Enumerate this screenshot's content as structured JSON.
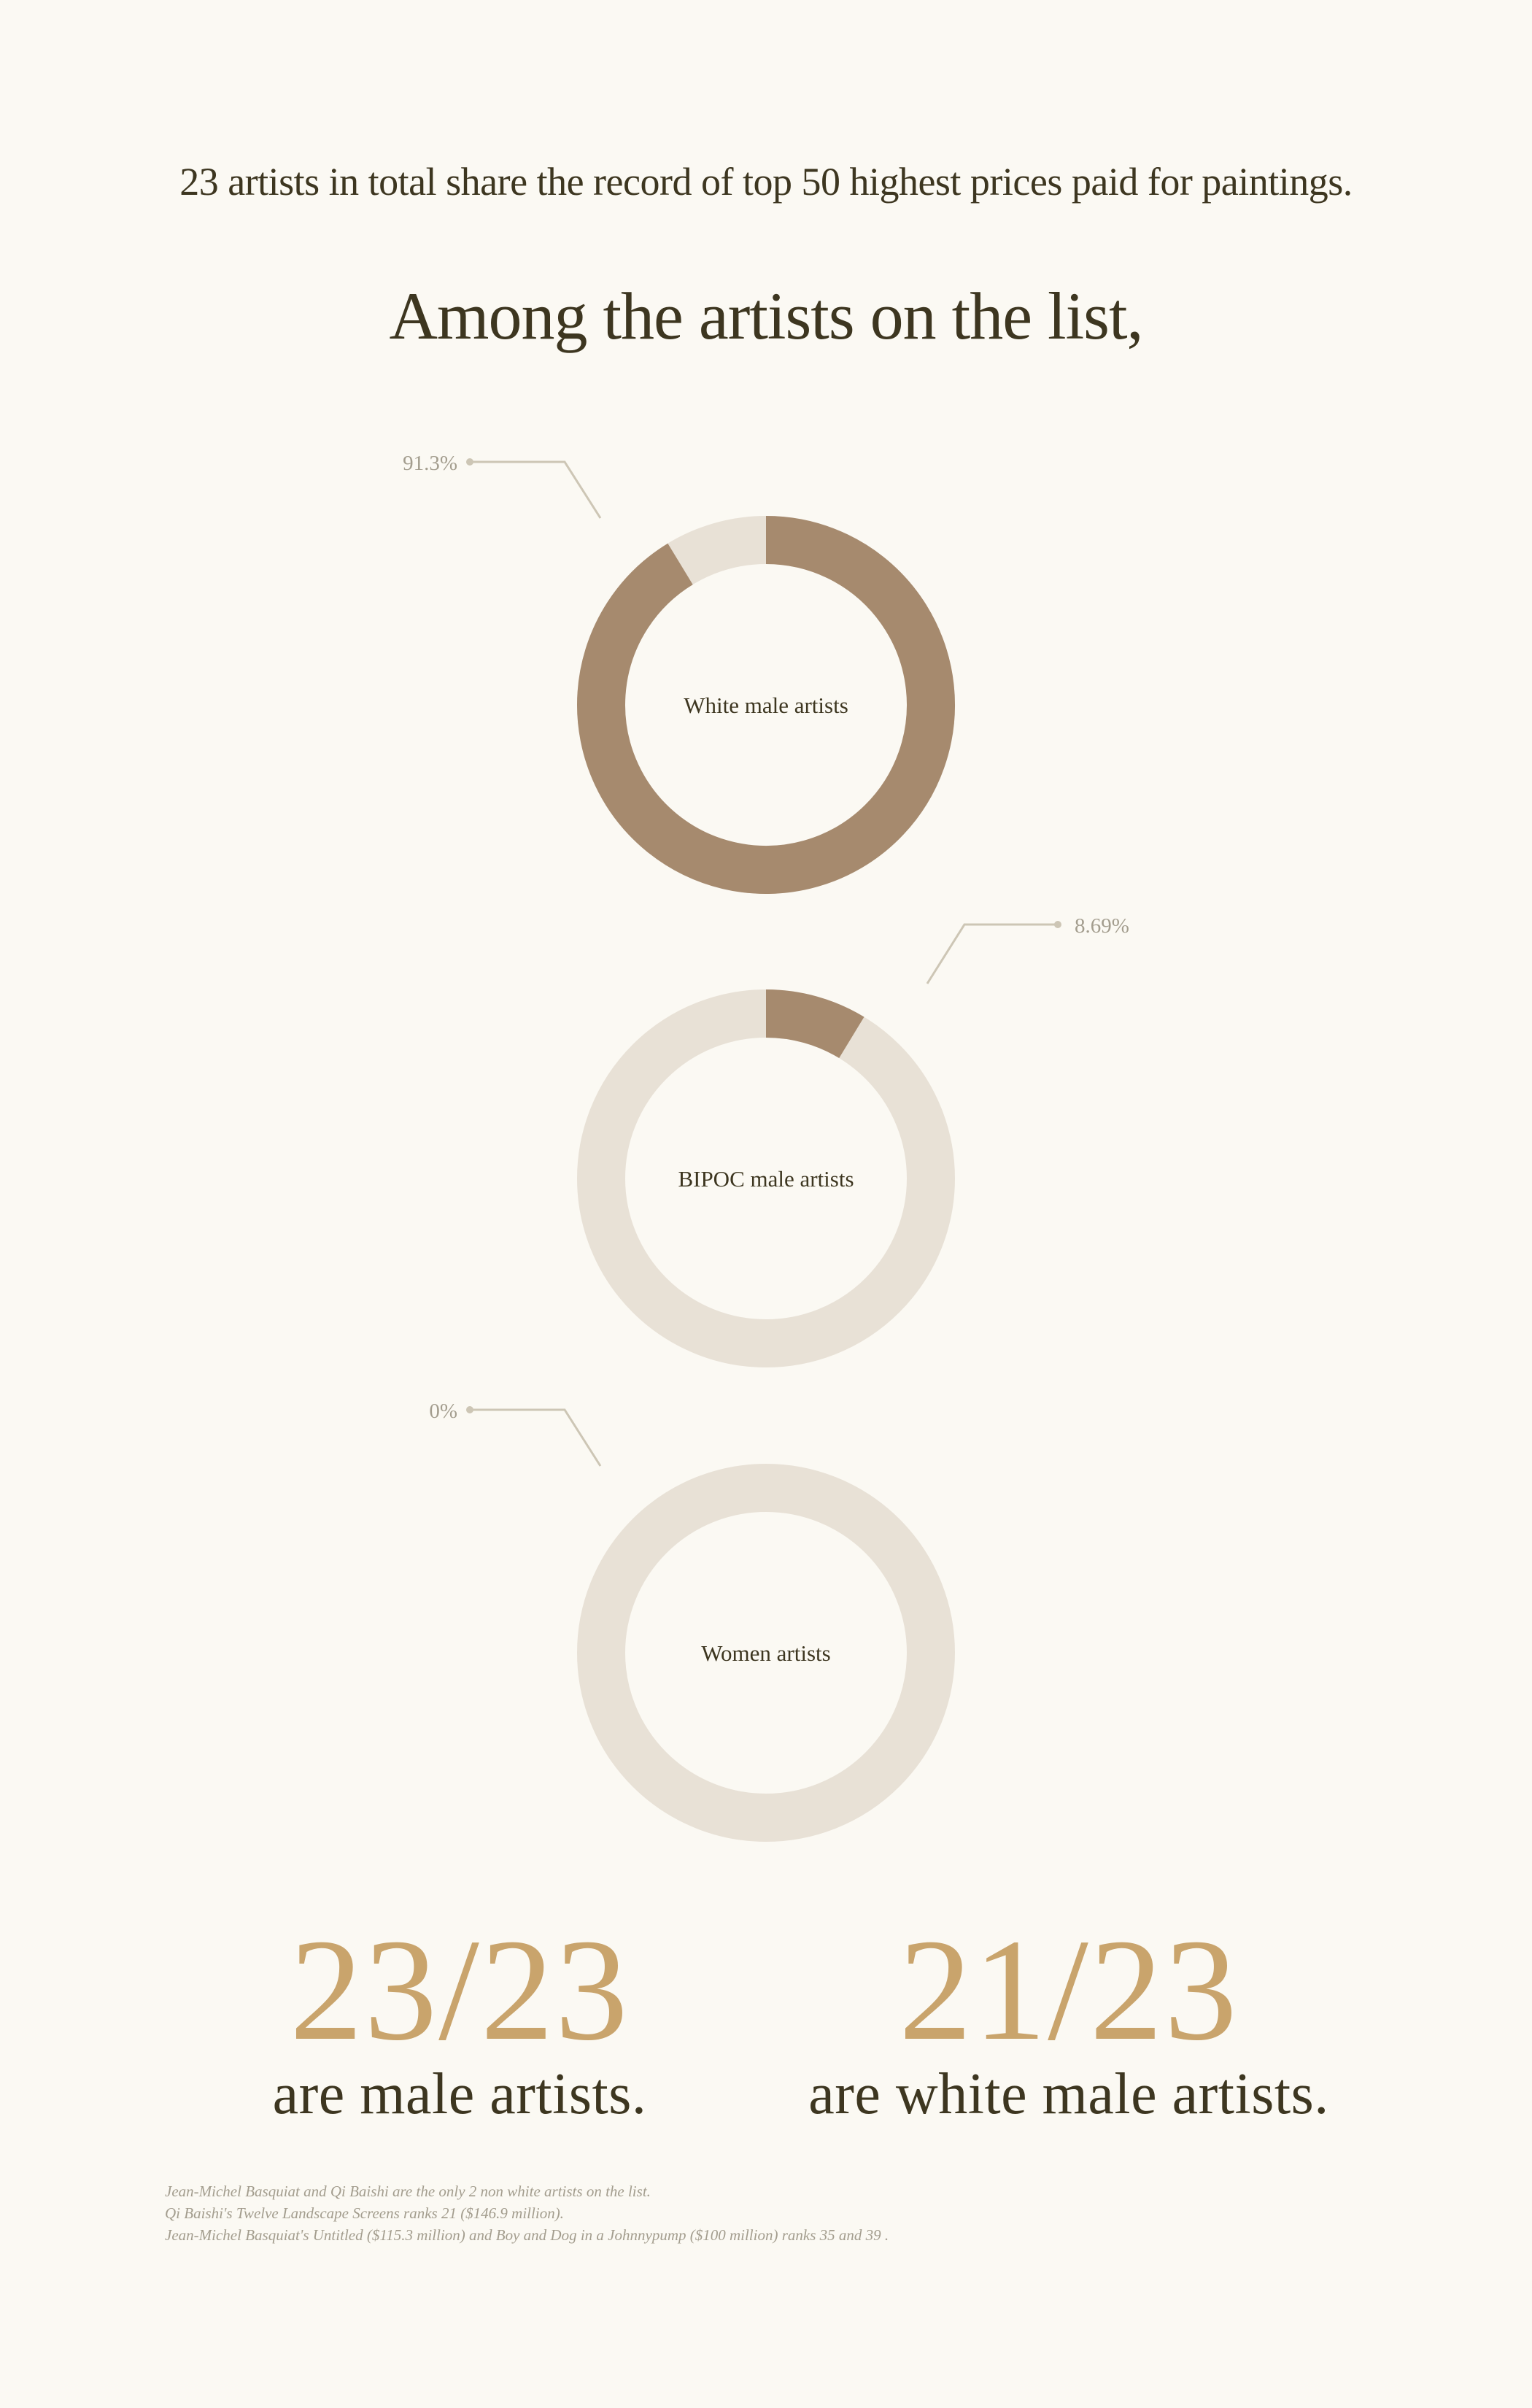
{
  "intro_text": "23 artists in total share the record of top 50 highest prices paid for paintings.",
  "heading": "Among the artists on the list,",
  "colors": {
    "background": "#fbf9f3",
    "filled": "#a68a6e",
    "track": "#e8e1d6",
    "callout": "#cdc6b5",
    "accent": "#c9a46c",
    "text": "#3d3620"
  },
  "chart_data": [
    {
      "type": "pie",
      "label": "White male artists",
      "value": 91.3,
      "value_label": "91.3%",
      "callout_side": "left"
    },
    {
      "type": "pie",
      "label": "BIPOC male artists",
      "value": 8.69,
      "value_label": "8.69%",
      "callout_side": "right"
    },
    {
      "type": "pie",
      "label": "Women artists",
      "value": 0,
      "value_label": "0%",
      "callout_side": "left"
    }
  ],
  "stats": [
    {
      "number": "23/23",
      "label": "are male artists."
    },
    {
      "number": "21/23",
      "label": "are white male artists."
    }
  ],
  "footnotes": [
    "Jean-Michel Basquiat and Qi Baishi are the only 2 non white artists on the list.",
    "Qi Baishi's Twelve Landscape Screens ranks 21 ($146.9 million).",
    "Jean-Michel Basquiat's Untitled ($115.3 million) and Boy and Dog in a Johnnypump ($100 million) ranks 35 and 39 ."
  ]
}
